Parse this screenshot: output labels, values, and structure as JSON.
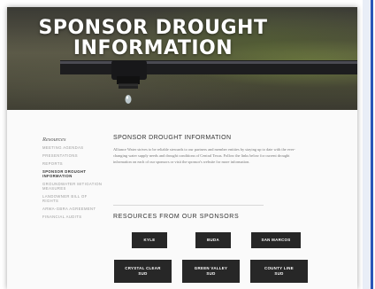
{
  "hero": {
    "title_line1": "SPONSOR DROUGHT",
    "title_line2": "INFORMATION"
  },
  "sidebar": {
    "heading": "Resources",
    "items": [
      {
        "label": "MEETING AGENDAS"
      },
      {
        "label": "PRESENTATIONS"
      },
      {
        "label": "REPORTS"
      },
      {
        "label": "SPONSOR DROUGHT INFORMATION",
        "active": true
      },
      {
        "label": "GROUNDWATER MITIGATION MEASURES"
      },
      {
        "label": "LANDOWNER BILL OF RIGHTS"
      },
      {
        "label": "ARWA-GBRA AGREEMENT"
      },
      {
        "label": "FINANCIAL AUDITS"
      }
    ]
  },
  "main": {
    "title": "SPONSOR DROUGHT INFORMATION",
    "paragraph": "Alliance Water strives to be reliable stewards to our partners and member entities by staying up to date with the ever-changing water supply needs and drought conditions of Central Texas. Follow the links below for current drought information on each of our sponsors or visit the sponsor's website for more information."
  },
  "resources": {
    "title": "RESOURCES FROM OUR SPONSORS",
    "sponsors": [
      {
        "label": "KYLE",
        "label2": ""
      },
      {
        "label": "BUDA",
        "label2": ""
      },
      {
        "label": "SAN MARCOS",
        "label2": ""
      },
      {
        "label": "CRYSTAL CLEAR",
        "label2": "SUD"
      },
      {
        "label": "GREEN VALLEY",
        "label2": "SUD"
      },
      {
        "label": "COUNTY LINE",
        "label2": "SUD"
      }
    ]
  },
  "colors": {
    "button_bg": "#272727",
    "frame_accent": "#2a56b8"
  }
}
